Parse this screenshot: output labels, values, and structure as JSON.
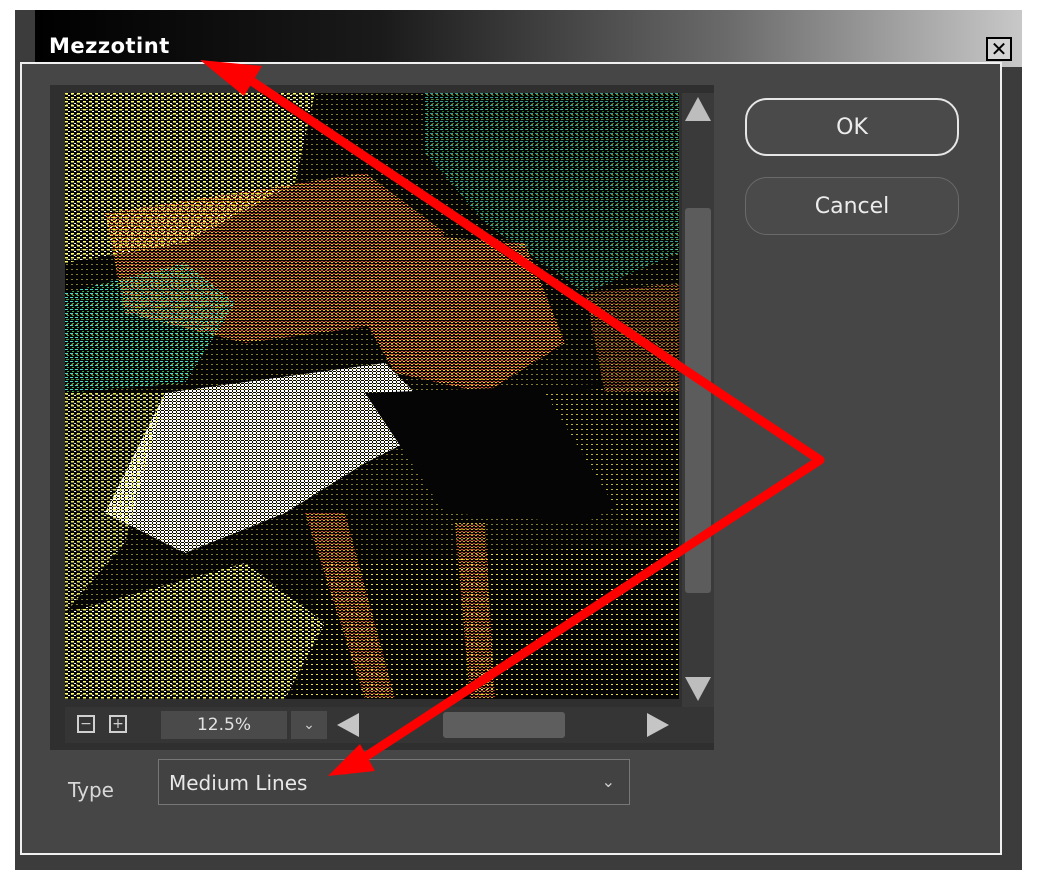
{
  "window": {
    "title": "Mezzotint",
    "close_glyph": "✕"
  },
  "preview": {
    "zoom_out_glyph": "−",
    "zoom_in_glyph": "+",
    "zoom_level": "12.5%",
    "zoom_dropdown_glyph": "⌄"
  },
  "buttons": {
    "ok": "OK",
    "cancel": "Cancel"
  },
  "type_field": {
    "label": "Type",
    "value": "Medium Lines",
    "chevron": "⌄"
  },
  "icons": {
    "close": "close-icon",
    "zoom_out": "zoom-out-icon",
    "zoom_in": "zoom-in-icon",
    "scroll_up": "arrow-up-icon",
    "scroll_down": "arrow-down-icon",
    "scroll_left": "arrow-left-icon",
    "scroll_right": "arrow-right-icon",
    "dropdown": "chevron-down-icon"
  },
  "colors": {
    "annotation": "#ff0000",
    "dialog_bg": "#3c3c3c",
    "panel_bg": "#464646"
  }
}
